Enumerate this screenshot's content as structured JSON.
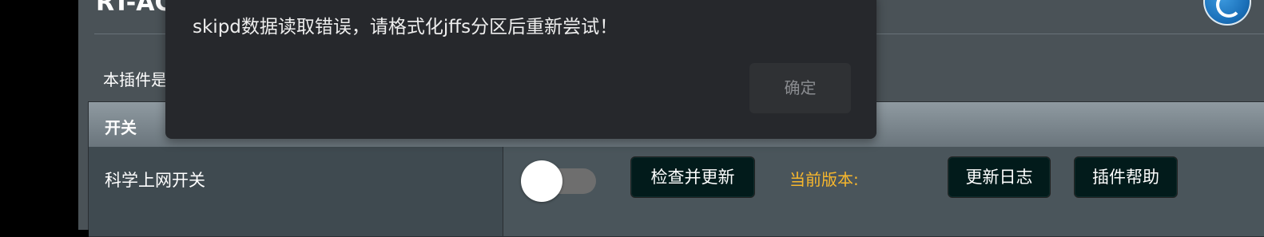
{
  "header": {
    "router_title": "RT-AC"
  },
  "description": "本插件是",
  "table": {
    "section_header": "开关",
    "row1": {
      "label": "科学上网开关",
      "check_update_button": "检查并更新",
      "version_label": "当前版本:",
      "changelog_button": "更新日志",
      "help_button": "插件帮助"
    },
    "row2": {
      "partial_text": ""
    }
  },
  "modal": {
    "message": "skipd数据读取错误，请格式化jffs分区后重新尝试！",
    "confirm_button": "确定"
  },
  "colors": {
    "accent_version": "#f7b72d",
    "modal_bg": "#26282c"
  }
}
